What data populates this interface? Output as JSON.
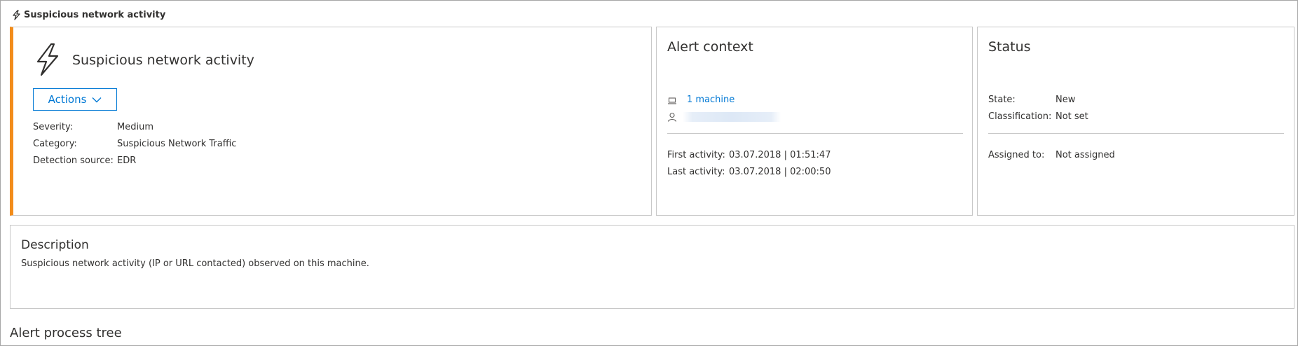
{
  "header": {
    "title": "Suspicious network activity"
  },
  "alert": {
    "title": "Suspicious network activity",
    "actions_label": "Actions",
    "details": [
      {
        "key": "Severity:",
        "value": "Medium"
      },
      {
        "key": "Category:",
        "value": "Suspicious Network Traffic"
      },
      {
        "key": "Detection source:",
        "value": "EDR"
      }
    ],
    "accent_color": "#f28c1b"
  },
  "context": {
    "title": "Alert context",
    "machine_link": "1 machine",
    "first_activity_label": "First activity:",
    "first_activity_value": "03.07.2018 | 01:51:47",
    "last_activity_label": "Last activity:",
    "last_activity_value": "03.07.2018 | 02:00:50"
  },
  "status": {
    "title": "Status",
    "state_label": "State:",
    "state_value": "New",
    "classification_label": "Classification:",
    "classification_value": "Not set",
    "assigned_label": "Assigned to:",
    "assigned_value": "Not assigned"
  },
  "description": {
    "title": "Description",
    "text": "Suspicious network activity (IP or URL contacted) observed on this machine."
  },
  "process_tree": {
    "title": "Alert process tree"
  },
  "colors": {
    "link": "#0078d4",
    "accent": "#f28c1b"
  }
}
